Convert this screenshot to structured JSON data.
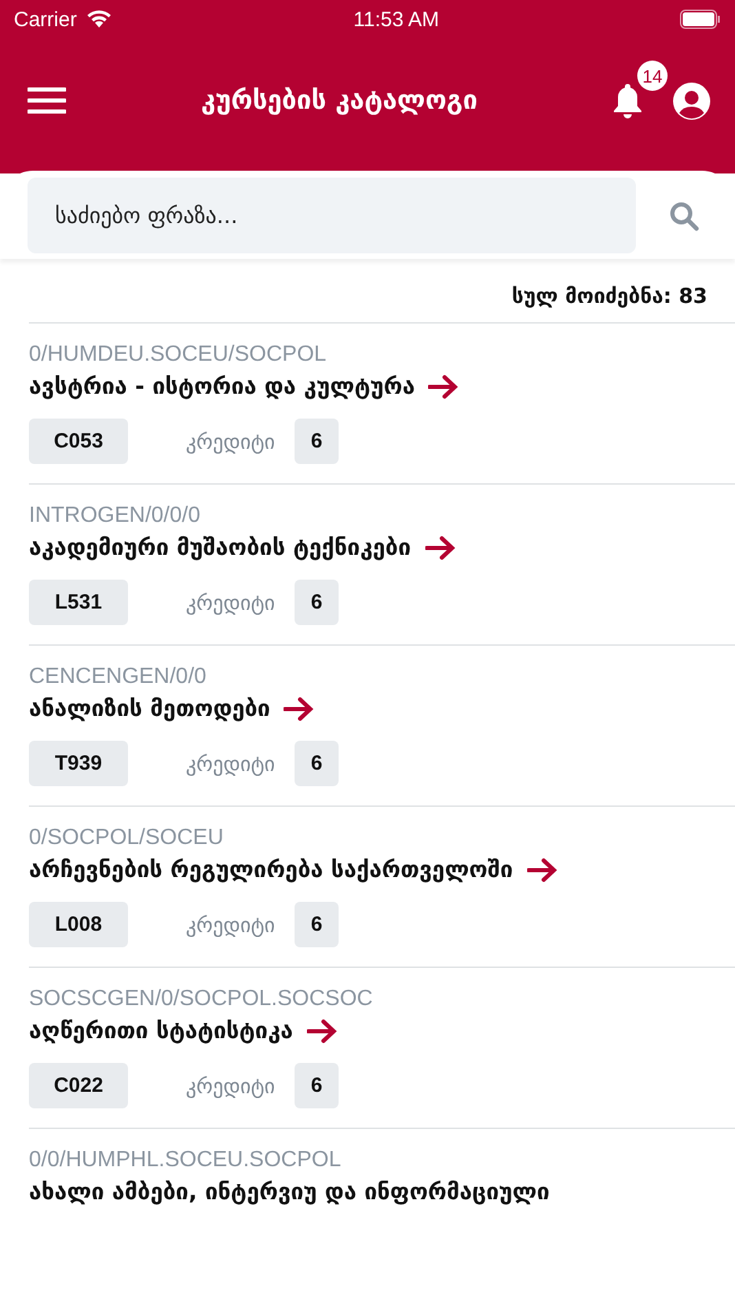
{
  "status_bar": {
    "carrier": "Carrier",
    "time": "11:53 AM"
  },
  "header": {
    "title": "კურსების კატალოგი",
    "notification_count": "14"
  },
  "search": {
    "placeholder": "საძიებო ფრაზა..."
  },
  "results_count": "სულ მოიძებნა: 83",
  "courses": [
    {
      "path": "0/HUMDEU.SOCEU/SOCPOL",
      "title": "ავსტრია - ისტორია და კულტურა",
      "code": "C053",
      "credits_label": "კრედიტი",
      "credits": "6"
    },
    {
      "path": "INTROGEN/0/0/0",
      "title": "აკადემიური მუშაობის ტექნიკები",
      "code": "L531",
      "credits_label": "კრედიტი",
      "credits": "6"
    },
    {
      "path": "CENCENGEN/0/0",
      "title": "ანალიზის მეთოდები",
      "code": "T939",
      "credits_label": "კრედიტი",
      "credits": "6"
    },
    {
      "path": "0/SOCPOL/SOCEU",
      "title": "არჩევნების რეგულირება საქართველოში",
      "code": "L008",
      "credits_label": "კრედიტი",
      "credits": "6"
    },
    {
      "path": "SOCSCGEN/0/SOCPOL.SOCSOC",
      "title": "აღწერითი სტატისტიკა",
      "code": "C022",
      "credits_label": "კრედიტი",
      "credits": "6"
    },
    {
      "path": "0/0/HUMPHL.SOCEU.SOCPOL",
      "title": "ახალი ამბები, ინტერვიუ და ინფორმაციული"
    }
  ]
}
